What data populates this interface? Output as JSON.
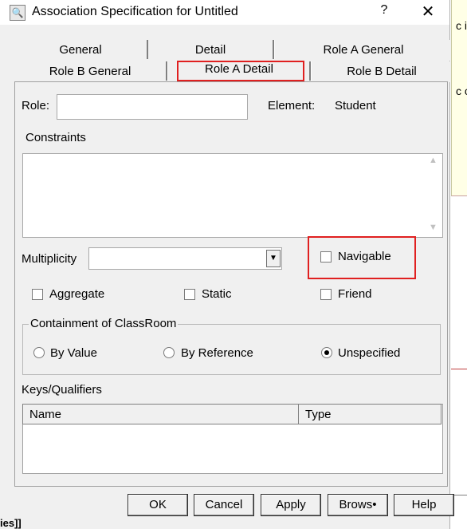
{
  "window": {
    "title": "Association Specification for Untitled",
    "help_label": "?",
    "close_label": "✕"
  },
  "background": {
    "right_text_1": "c in",
    "right_text_2": "c cl",
    "left_bottom_text": "ies]]"
  },
  "tabs": {
    "row1": [
      "General",
      "Detail",
      "Role A General"
    ],
    "row2": [
      "Role B General",
      "Role A Detail",
      "Role B Detail"
    ],
    "active": "Role A Detail"
  },
  "role": {
    "label": "Role:",
    "value": "",
    "element_label": "Element:",
    "element_value": "Student"
  },
  "constraints": {
    "label": "Constraints",
    "value": ""
  },
  "multiplicity": {
    "label": "Multiplicity",
    "value": ""
  },
  "checkboxes": {
    "navigable": {
      "label": "Navigable",
      "checked": false
    },
    "aggregate": {
      "label": "Aggregate",
      "checked": false
    },
    "static": {
      "label": "Static",
      "checked": false
    },
    "friend": {
      "label": "Friend",
      "checked": false
    }
  },
  "containment": {
    "title": "Containment of ClassRoom",
    "options": [
      "By Value",
      "By Reference",
      "Unspecified"
    ],
    "selected": "Unspecified"
  },
  "keys": {
    "label": "Keys/Qualifiers",
    "columns": [
      "Name",
      "Type"
    ],
    "rows": []
  },
  "buttons": {
    "ok": "OK",
    "cancel": "Cancel",
    "apply": "Apply",
    "browse": "Brows•",
    "help": "Help"
  },
  "colors": {
    "highlight": "#e02020",
    "dialog_bg": "#f0f0f0"
  }
}
